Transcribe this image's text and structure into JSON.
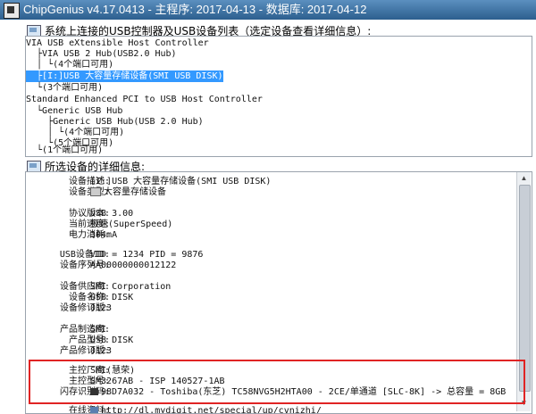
{
  "window": {
    "title": "ChipGenius v4.17.0413 - 主程序: 2017-04-13 - 数据库: 2017-04-12"
  },
  "device_list": {
    "header": "系统上连接的USB控制器及USB设备列表（选定设备查看详细信息）:",
    "items": [
      "VIA USB eXtensible Host Controller",
      "  ├VIA USB 2 Hub(USB2.0 Hub)",
      "  │ └(4个端口可用)",
      "  ├[I:]USB 大容量存储设备(SMI USB DISK)",
      "  └(3个端口可用)",
      "Standard Enhanced PCI to USB Host Controller",
      "  └Generic USB Hub",
      "    ├Generic USB Hub(USB 2.0 Hub)",
      "    │ └(4个端口可用)",
      "    └(5个端口可用)",
      "  └(1个端口可用)"
    ],
    "selected_index": 3
  },
  "details": {
    "header": "所选设备的详细信息:",
    "labels": {
      "desc": "设备描述:",
      "type": "设备类型:",
      "protocol": "协议版本:",
      "speed": "当前速度:",
      "power": "电力消耗:",
      "usbid": "USB设备ID:",
      "serial": "设备序列号:",
      "vendor": "设备供应商:",
      "name": "设备名称:",
      "revision": "设备修订版:",
      "mfr": "产品制造商:",
      "model": "产品型号:",
      "prodrev": "产品修订版:",
      "controller_vendor": "主控厂商:",
      "controller_model": "主控型号:",
      "flash_id": "闪存识别码:",
      "tools": "在线资料:"
    },
    "values": {
      "desc": "[I:]USB 大容量存储设备(SMI USB DISK)",
      "type": "大容量存储设备",
      "protocol": "USB 3.00",
      "speed": "极速(SuperSpeed)",
      "power": "304mA",
      "usbid": "VID = 1234 PID = 9876",
      "serial": "AA00000000012122",
      "vendor": "SMI Corporation",
      "name": "USB DISK",
      "revision": "0123",
      "mfr": "SMI",
      "model": "USB DISK",
      "prodrev": "0123",
      "controller_vendor": "SMI(慧荣)",
      "controller_model": "SM3267AB - ISP 140527-1AB",
      "flash_id": "98D7A032 - Toshiba(东芝) TC58NVG5H2HTA00 - 2CE/单通道 [SLC-8K] -> 总容量 = 8GB",
      "tools": "http://dl.mydigit.net/special/up/cvnizhi/"
    }
  },
  "colors": {
    "selection": "#3399ff",
    "highlight_border": "#e02424"
  }
}
